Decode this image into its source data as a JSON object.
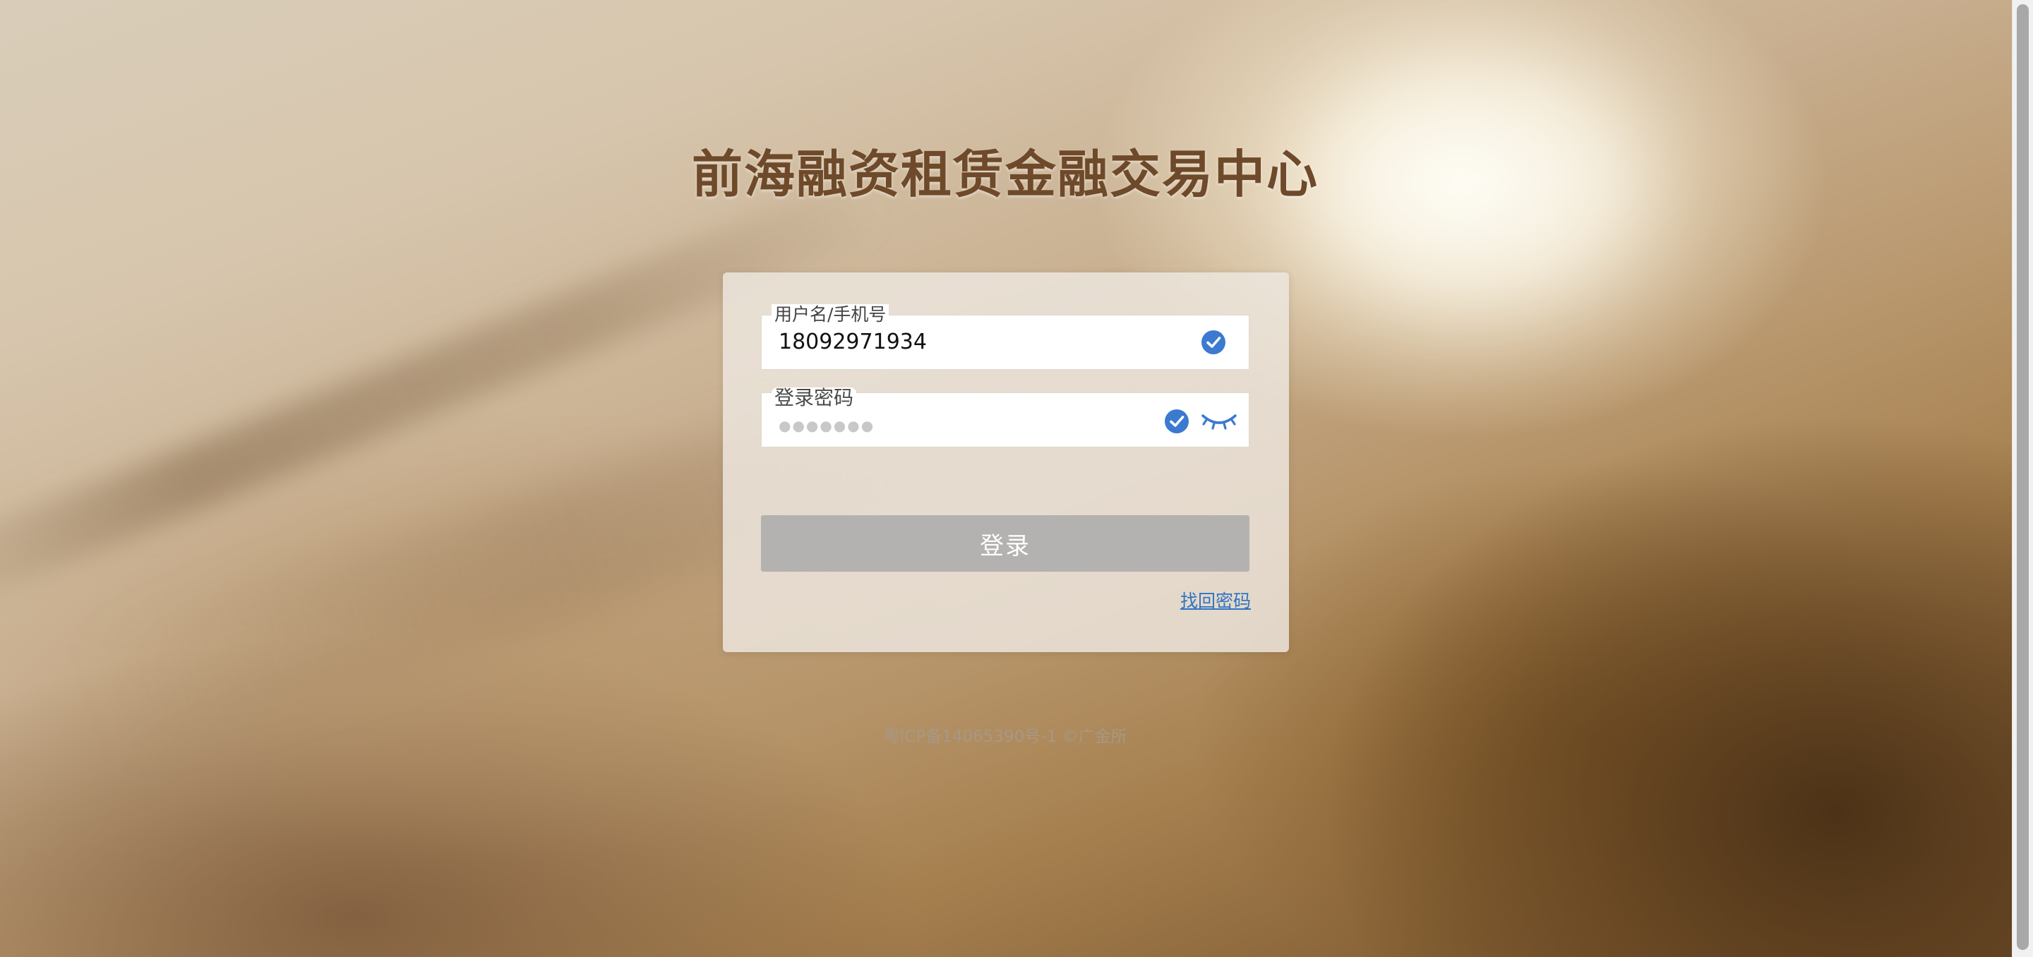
{
  "page": {
    "title": "前海融资租赁金融交易中心"
  },
  "login_form": {
    "username": {
      "label": "用户名/手机号",
      "value": "18092971934"
    },
    "password": {
      "label": "登录密码",
      "masked_value": "●●●●●●●"
    },
    "login_button": "登录",
    "forgot_password": "找回密码"
  },
  "footer": {
    "text": "粤ICP备14065390号-1 ©广金所"
  },
  "colors": {
    "title": "#6e4a2a",
    "check_icon": "#3b7ad0",
    "button_bg": "#b3b2b1",
    "link": "#2f74c4"
  },
  "icons": {
    "username_valid": "check-circle-icon",
    "password_valid": "check-circle-icon",
    "toggle_password": "eye-closed-icon"
  }
}
